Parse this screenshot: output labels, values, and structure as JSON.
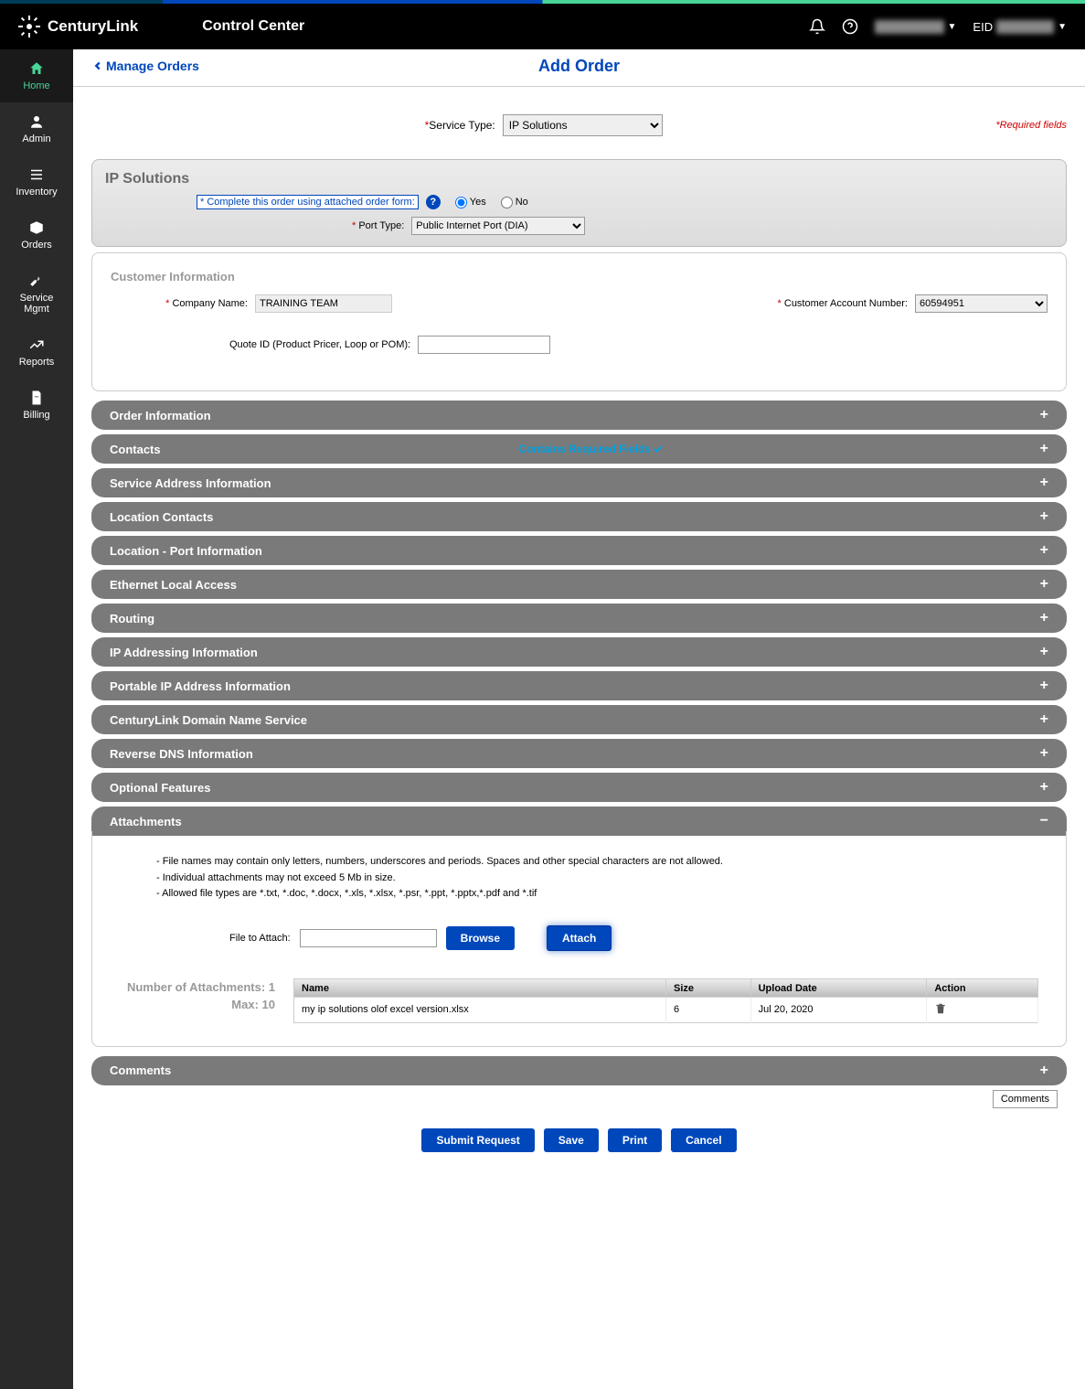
{
  "header": {
    "brand": "CenturyLink",
    "product": "Control Center",
    "eid_label": "EID"
  },
  "nav": {
    "home": "Home",
    "admin": "Admin",
    "inventory": "Inventory",
    "orders": "Orders",
    "service_mgmt": "Service\nMgmt",
    "reports": "Reports",
    "billing": "Billing"
  },
  "page": {
    "back": "Manage Orders",
    "title": "Add Order",
    "required_fields": "Required fields",
    "service_type_label": "Service Type:",
    "service_type_value": "IP Solutions"
  },
  "ip_solutions": {
    "title": "IP Solutions",
    "order_form_label": "* Complete this order using attached order form:",
    "yes": "Yes",
    "no": "No",
    "port_type_label": "Port Type:",
    "port_type_value": "Public Internet Port (DIA)"
  },
  "customer": {
    "title": "Customer Information",
    "company_label": "Company Name:",
    "company_value": "TRAINING TEAM",
    "account_label": "Customer Account Number:",
    "account_value": "60594951",
    "quote_label": "Quote ID (Product Pricer, Loop or POM):"
  },
  "accordions": [
    {
      "label": "Order Information"
    },
    {
      "label": "Contacts",
      "contains_required": true
    },
    {
      "label": "Service Address Information"
    },
    {
      "label": "Location Contacts"
    },
    {
      "label": "Location - Port Information"
    },
    {
      "label": "Ethernet Local Access"
    },
    {
      "label": "Routing"
    },
    {
      "label": "IP Addressing Information"
    },
    {
      "label": "Portable IP Address Information"
    },
    {
      "label": "CenturyLink Domain Name Service"
    },
    {
      "label": "Reverse DNS Information"
    },
    {
      "label": "Optional Features"
    }
  ],
  "attachments": {
    "title": "Attachments",
    "note1": "- File names may contain only letters, numbers, underscores and periods. Spaces and other special characters are not allowed.",
    "note2": "- Individual attachments may not exceed 5 Mb in size.",
    "note3": "- Allowed file types are *.txt, *.doc, *.docx, *.xls, *.xlsx, *.psr, *.ppt, *.pptx,*.pdf and *.tif",
    "file_label": "File to Attach:",
    "browse": "Browse",
    "attach": "Attach",
    "count_label": "Number of Attachments: 1",
    "max_label": "Max: 10",
    "col_name": "Name",
    "col_size": "Size",
    "col_date": "Upload Date",
    "col_action": "Action",
    "row_name": "my ip solutions olof excel version.xlsx",
    "row_size": "6",
    "row_date": "Jul 20, 2020"
  },
  "contains_required_text": "Contains Required Fields",
  "comments": {
    "title": "Comments",
    "tooltip": "Comments"
  },
  "buttons": {
    "submit": "Submit Request",
    "save": "Save",
    "print": "Print",
    "cancel": "Cancel"
  }
}
